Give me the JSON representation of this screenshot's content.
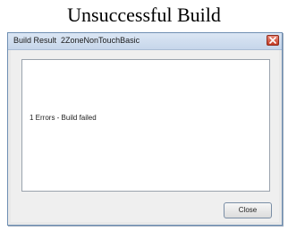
{
  "caption": "Unsuccessful Build",
  "window": {
    "title": "Build Result  2ZoneNonTouchBasic",
    "close_icon": "close-x-icon",
    "message": "1 Errors - Build failed",
    "close_button_label": "Close"
  },
  "colors": {
    "titlebar": "#c6d6ea",
    "close_red": "#c53b25",
    "pane_bg": "#ffffff"
  }
}
